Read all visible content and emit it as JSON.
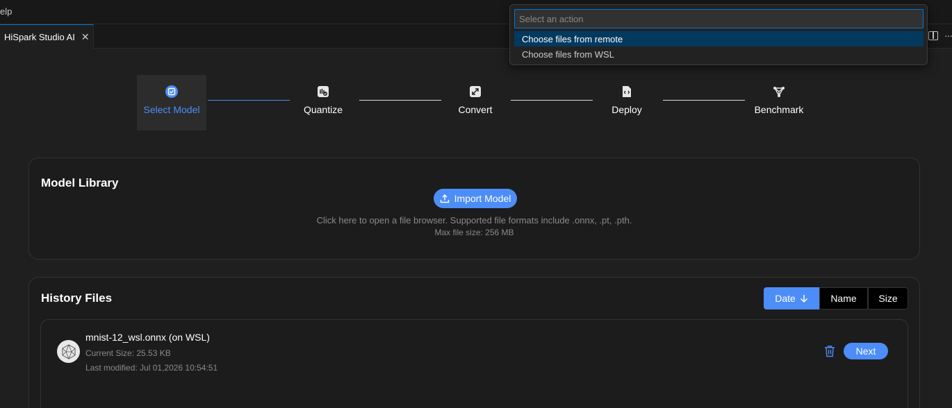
{
  "menubar": {
    "help_label": "elp"
  },
  "tab": {
    "title": "HiSpark Studio AI",
    "close_glyph": "✕",
    "more_glyph": "···"
  },
  "stepper": {
    "steps": [
      {
        "label": "Select Model",
        "icon": "select-model-icon",
        "state": "active"
      },
      {
        "label": "Quantize",
        "icon": "quantize-icon",
        "state": "pending"
      },
      {
        "label": "Convert",
        "icon": "convert-icon",
        "state": "pending"
      },
      {
        "label": "Deploy",
        "icon": "deploy-icon",
        "state": "pending"
      },
      {
        "label": "Benchmark",
        "icon": "benchmark-icon",
        "state": "pending"
      }
    ]
  },
  "model_library": {
    "title": "Model Library",
    "import_label": "Import Model",
    "help_text": "Click here to open a file browser. Supported file formats include .onnx, .pt, .pth.",
    "max_size_text": "Max file size: 256 MB"
  },
  "history": {
    "title": "History Files",
    "sort": {
      "date_label": "Date",
      "name_label": "Name",
      "size_label": "Size",
      "active": "date",
      "direction": "descending"
    },
    "files": [
      {
        "name": "mnist-12_wsl.onnx (on WSL)",
        "size_text": "Current Size: 25.53 KB",
        "modified_text": "Last modified: Jul 01,2026 10:54:51",
        "next_label": "Next"
      }
    ]
  },
  "quickpick": {
    "placeholder": "Select an action",
    "items": [
      {
        "label": "Choose files from remote",
        "selected": true
      },
      {
        "label": "Choose files from WSL",
        "selected": false
      }
    ]
  },
  "colors": {
    "accent": "#4d8df7",
    "background": "#1f1f1f",
    "quickpick_selection": "#04395e",
    "focus_border": "#0078d4"
  }
}
